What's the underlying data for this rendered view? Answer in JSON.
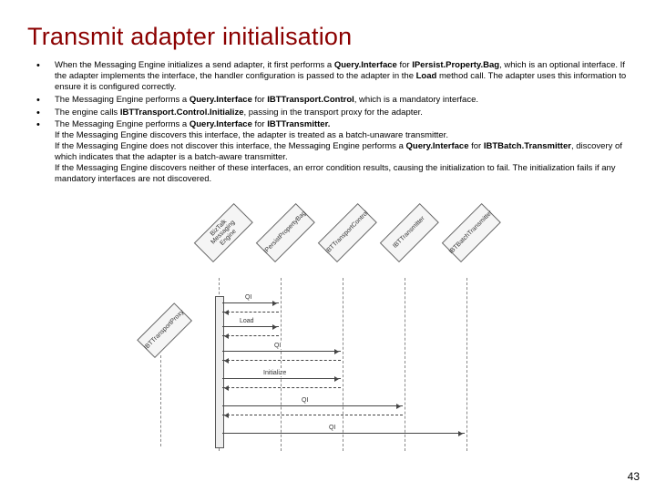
{
  "title": "Transmit adapter initialisation",
  "bullets": {
    "b1": {
      "pre": "When the Messaging Engine initializes a send adapter, it first performs a ",
      "strong1": "Query.Interface",
      "mid1": " for ",
      "strong2": "IPersist.Property.Bag",
      "mid2": ", which is an optional interface. If the adapter implements the interface, the handler configuration is passed to the adapter in the ",
      "strong3": "Load",
      "post": " method call. The adapter uses this information to ensure it is configured correctly."
    },
    "b2": {
      "pre": "The Messaging Engine performs a ",
      "strong1": "Query.Interface",
      "mid1": " for ",
      "strong2": "IBTTransport.Control",
      "post": ", which is a mandatory interface."
    },
    "b3": {
      "pre": "The engine calls ",
      "strong1": "IBTTransport.Control.Initialize",
      "post": ", passing in the transport proxy for the adapter."
    },
    "b4": {
      "l1pre": "The Messaging Engine performs a ",
      "l1s1": "Query.Interface",
      "l1mid": " for ",
      "l1s2": "IBTTransmitter.",
      "l2": "If the Messaging Engine discovers this interface, the adapter is treated as a batch-unaware transmitter.",
      "l3pre": "If the Messaging Engine does not discover this interface, the Messaging Engine performs a ",
      "l3s1": "Query.Interface",
      "l3mid": " for ",
      "l3s2": "IBTBatch.Transmitter",
      "l3post": ", discovery of which indicates that the adapter is a batch-aware transmitter.",
      "l4": "If the Messaging Engine discovers neither of these interfaces, an error condition results, causing the initialization to fail. The initialization fails if any mandatory interfaces are not discovered."
    }
  },
  "diagram": {
    "heads": {
      "engine": "BizTalk Messaging Engine",
      "bag": "IPersistPropertyBag",
      "ctrl": "IBTTransportControl",
      "tx": "IBTTransmitter",
      "batch": "IBTBatchTransmitter",
      "proxy": "IBTTransportProxy"
    },
    "labels": {
      "qi": "QI",
      "load": "Load",
      "init": "Initialize",
      "qi2": "QI"
    }
  },
  "page_number": "43"
}
